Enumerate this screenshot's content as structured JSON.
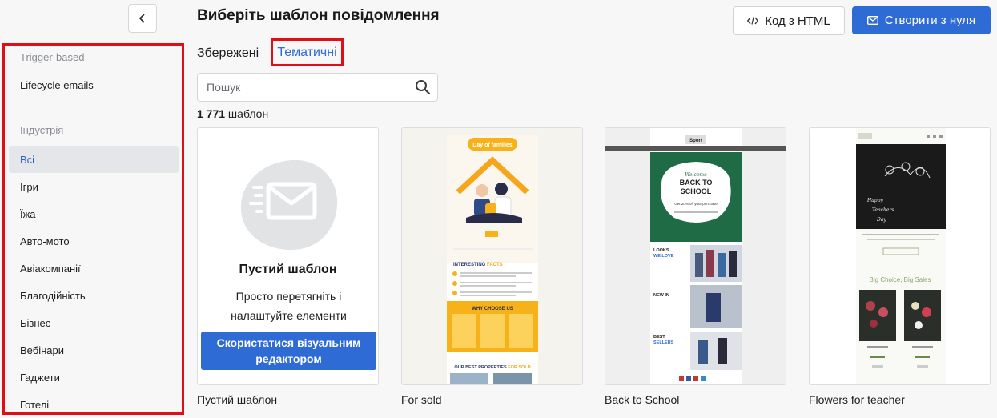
{
  "header": {
    "title": "Виберіть шаблон повідомлення",
    "code_html_label": "Код з HTML",
    "create_label": "Створити з нуля"
  },
  "sidebar": {
    "items": [
      {
        "label": "Trigger-based",
        "kind": "heading"
      },
      {
        "label": "Lifecycle emails",
        "kind": "item"
      },
      {
        "label": "Індустрія",
        "kind": "heading"
      },
      {
        "label": "Всі",
        "kind": "item",
        "active": true
      },
      {
        "label": "Ігри",
        "kind": "item"
      },
      {
        "label": "Їжа",
        "kind": "item"
      },
      {
        "label": "Авто-мото",
        "kind": "item"
      },
      {
        "label": "Авіакомпанії",
        "kind": "item"
      },
      {
        "label": "Благодійність",
        "kind": "item"
      },
      {
        "label": "Бізнес",
        "kind": "item"
      },
      {
        "label": "Вебінари",
        "kind": "item"
      },
      {
        "label": "Гаджети",
        "kind": "item"
      },
      {
        "label": "Готелі",
        "kind": "item"
      }
    ]
  },
  "tabs": {
    "saved": "Збережені",
    "thematic": "Тематичні"
  },
  "search": {
    "placeholder": "Пошук"
  },
  "count": {
    "number": "1 771",
    "suffix": " шаблон"
  },
  "blank": {
    "title": "Пустий шаблон",
    "description": "Просто перетягніть і налаштуйте елементи",
    "button": "Скористатися візуальним редактором"
  },
  "cards": [
    {
      "name": "Пустий шаблон"
    },
    {
      "name": "For sold"
    },
    {
      "name": "Back to School"
    },
    {
      "name": "Flowers for teacher"
    }
  ],
  "thumbs": {
    "for_sold": {
      "hero": "Day of families",
      "facts_a": "INTERESTING ",
      "facts_b": "FACTS",
      "why": "WHY CHOOSE US",
      "props_a": "OUR BEST PROPERTIES ",
      "props_b": "FOR SOLD"
    },
    "school": {
      "brand": "Sport",
      "welcome": "Welcome",
      "line1": "BACK TO",
      "line2": "SCHOOL",
      "offer": "Get 20% off your purchase",
      "looks_a": "LOOKS",
      "looks_b": "WE LOVE",
      "new_in": "NEW IN",
      "best_a": "BEST",
      "best_b": "SELLERS"
    },
    "flowers": {
      "card_1": "Happy",
      "card_2": "Teachers",
      "card_3": "Day",
      "section": "Big Choice, Big Sales"
    }
  },
  "colors": {
    "accent": "#2f6bd4",
    "highlight_border": "#e10e17",
    "active_bg": "#e5e6ea"
  },
  "icons": {
    "collapse": "chevron-left-icon",
    "code": "code-icon",
    "create": "envelope-icon",
    "search": "search-icon"
  }
}
